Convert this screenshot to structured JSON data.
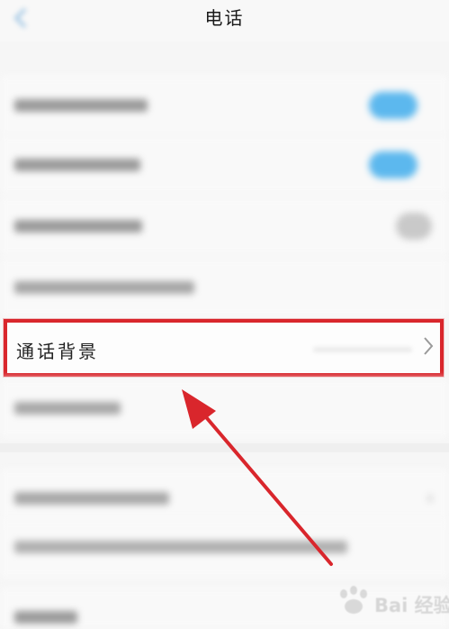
{
  "header": {
    "title": "电话"
  },
  "settings": {
    "rows": [
      {
        "label": "",
        "control": "toggle",
        "state": "on"
      },
      {
        "label": "",
        "control": "toggle",
        "state": "on"
      },
      {
        "label": "",
        "control": "toggle",
        "state": "off"
      },
      {
        "label": "",
        "control": "none"
      }
    ],
    "highlighted": {
      "label": "通话背景"
    },
    "rows_after": [
      {
        "label": ""
      },
      {
        "label": ""
      },
      {
        "label": ""
      }
    ]
  },
  "colors": {
    "toggle_on": "#5cb8ee",
    "toggle_off": "#c9c9c9",
    "highlight_border": "#d9262c",
    "arrow": "#d9262c"
  },
  "icons": {
    "back": "back-arrow-icon",
    "row_chevron": "chevron-right-icon",
    "watermark": "baidu-paw-logo"
  },
  "watermark": {
    "text": "Bai 经验"
  }
}
